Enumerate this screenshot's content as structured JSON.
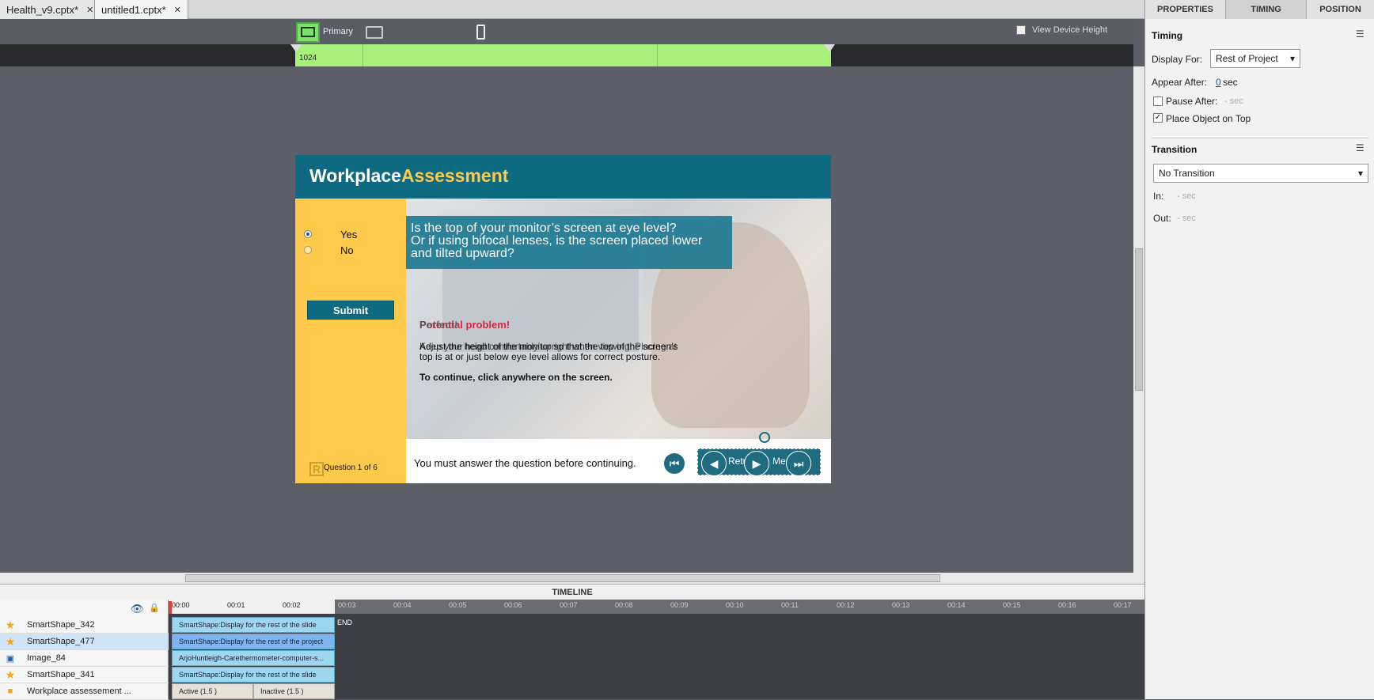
{
  "tabs": [
    {
      "label": "Health_v9.cptx*"
    },
    {
      "label": "untitled1.cptx*"
    }
  ],
  "device_bar": {
    "primary_label": "Primary",
    "view_device_height": "View Device Height",
    "ruler_value": "1024"
  },
  "panel": {
    "tabs": [
      "PROPERTIES",
      "TIMING",
      "POSITION"
    ],
    "timing_header": "Timing",
    "display_for_label": "Display For:",
    "display_for_value": "Rest of Project",
    "appear_after_label": "Appear After:",
    "appear_after_value": "0",
    "appear_after_unit": "sec",
    "pause_after_label": "Pause After:",
    "pause_after_value": "- sec",
    "place_on_top_label": "Place Object on Top",
    "transition_header": "Transition",
    "transition_value": "No Transition",
    "in_label": "In:",
    "in_value": "- sec",
    "out_label": "Out:",
    "out_value": "- sec"
  },
  "slide": {
    "title_a": "Workplace",
    "title_b": "Assessment",
    "option_yes": "Yes",
    "option_no": "No",
    "submit": "Submit",
    "question_count": "Question 1 of 6",
    "question_line1": "Is the top of your monitor’s screen at eye level?",
    "question_line2": "Or if using bifocal lenses, is the screen placed lower",
    "question_line3": "and tilted upward?",
    "feedback_title_a": "Potential problem!",
    "feedback_title_b": "Perfect!",
    "feedback_body1": "Adjust the height of the monitor so that the top of the screen’s",
    "feedback_body2": "Keep your head comfortably upright when viewing. Placing at",
    "feedback_body3": "top is at or just below eye level allows for correct posture.",
    "continue": "To continue, click anywhere on the screen.",
    "must_answer": "You must answer the question before continuing.",
    "btn_return": "Return",
    "btn_menu": "Menu"
  },
  "timeline": {
    "title": "TIMELINE",
    "ticks": [
      "00:00",
      "00:01",
      "00:02",
      "00:03",
      "00:04",
      "00:05",
      "00:06",
      "00:07",
      "00:08",
      "00:09",
      "00:10",
      "00:11",
      "00:12",
      "00:13",
      "00:14",
      "00:15",
      "00:16",
      "00:17"
    ],
    "end_label": "END",
    "rows": [
      {
        "name": "SmartShape_342",
        "bar": "SmartShape:Display for the rest of the slide"
      },
      {
        "name": "SmartShape_477",
        "bar": "SmartShape:Display for the rest of the project"
      },
      {
        "name": "Image_84",
        "bar": "ArjoHuntleigh-Carethermometer-computer-s..."
      },
      {
        "name": "SmartShape_341",
        "bar": "SmartShape:Display for the rest of the slide"
      },
      {
        "name": "Workplace assessement ...",
        "bar_a": "Active (1.5 )",
        "bar_b": "Inactive (1.5 )"
      }
    ]
  }
}
